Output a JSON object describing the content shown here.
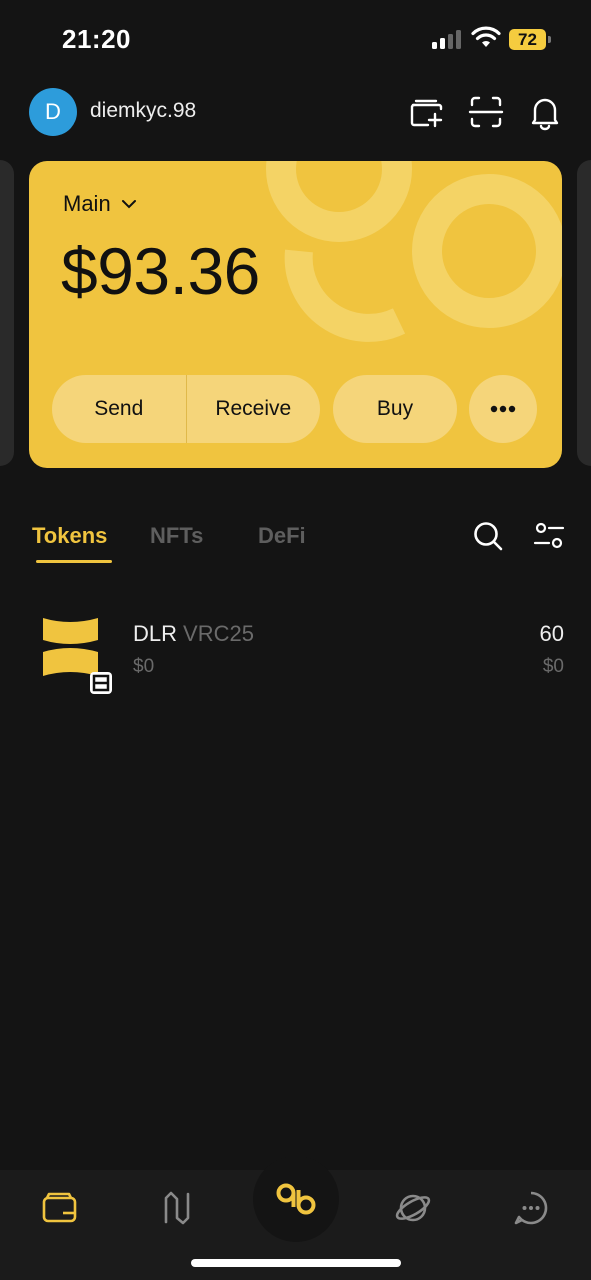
{
  "status_bar": {
    "time": "21:20",
    "battery": "72",
    "icons": [
      "signal-icon",
      "wifi-icon",
      "battery-icon"
    ]
  },
  "header": {
    "avatar_initial": "D",
    "account_name": "diemkyc.98",
    "icons": [
      "add-wallet-icon",
      "scan-icon",
      "bell-icon"
    ]
  },
  "card": {
    "wallet_name": "Main",
    "balance": "$93.36",
    "actions": {
      "send": "Send",
      "receive": "Receive",
      "buy": "Buy"
    },
    "color": "#f0c43f"
  },
  "tabs": {
    "items": [
      {
        "label": "Tokens",
        "active": true
      },
      {
        "label": "NFTs"
      },
      {
        "label": "DeFi"
      }
    ],
    "tools": [
      "search-icon",
      "filter-icon"
    ]
  },
  "tokens": [
    {
      "symbol": "DLR",
      "standard": "VRC25",
      "fiat": "$0",
      "amount": "60",
      "amount_fiat": "$0"
    }
  ],
  "bottom_nav": {
    "items": [
      "wallet-icon",
      "swap-icon",
      "home-logo-icon",
      "explore-icon",
      "chat-icon"
    ]
  },
  "colors": {
    "accent": "#f0c43f",
    "background": "#141414",
    "avatar": "#2d9cdb"
  }
}
